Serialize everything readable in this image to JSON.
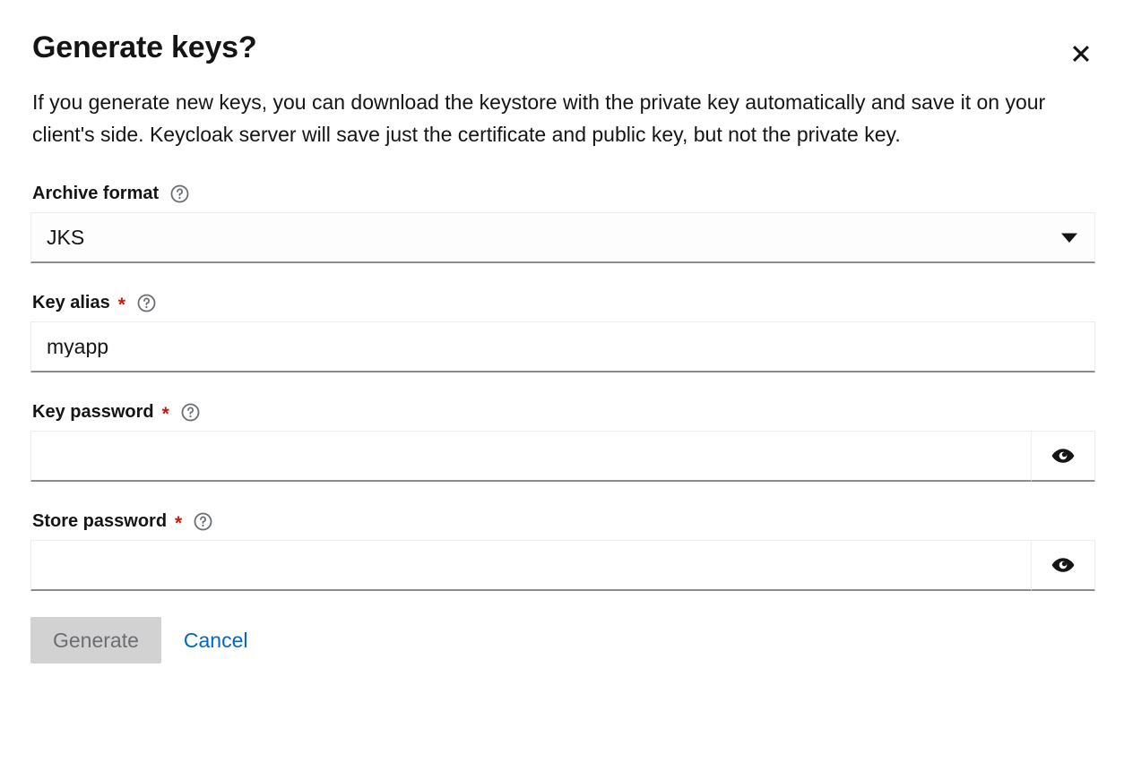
{
  "dialog": {
    "title": "Generate keys?",
    "description": "If you generate new keys, you can download the keystore with the private key automatically and save it on your client's side. Keycloak server will save just the certificate and public key, but not the private key.",
    "close_label": "Close"
  },
  "form": {
    "archive_format": {
      "label": "Archive format",
      "required": false,
      "help": "help-icon",
      "value": "JKS",
      "placeholder": "",
      "options": [
        "JKS"
      ]
    },
    "key_alias": {
      "label": "Key alias",
      "required": true,
      "required_marker": "*",
      "help": "help-icon",
      "value": "myapp",
      "placeholder": ""
    },
    "key_password": {
      "label": "Key password",
      "required": true,
      "required_marker": "*",
      "help": "help-icon",
      "value": "",
      "placeholder": "",
      "reveal_label": "Show password"
    },
    "store_password": {
      "label": "Store password",
      "required": true,
      "required_marker": "*",
      "help": "help-icon",
      "value": "",
      "placeholder": "",
      "reveal_label": "Show password"
    }
  },
  "footer": {
    "generate_label": "Generate",
    "generate_disabled": true,
    "cancel_label": "Cancel"
  },
  "colors": {
    "accent_link": "#0066cc",
    "required_red": "#c9190b",
    "disabled_bg": "#d2d2d2",
    "disabled_text": "#6a6e73",
    "text": "#151515",
    "input_underline": "#8a8d90"
  }
}
